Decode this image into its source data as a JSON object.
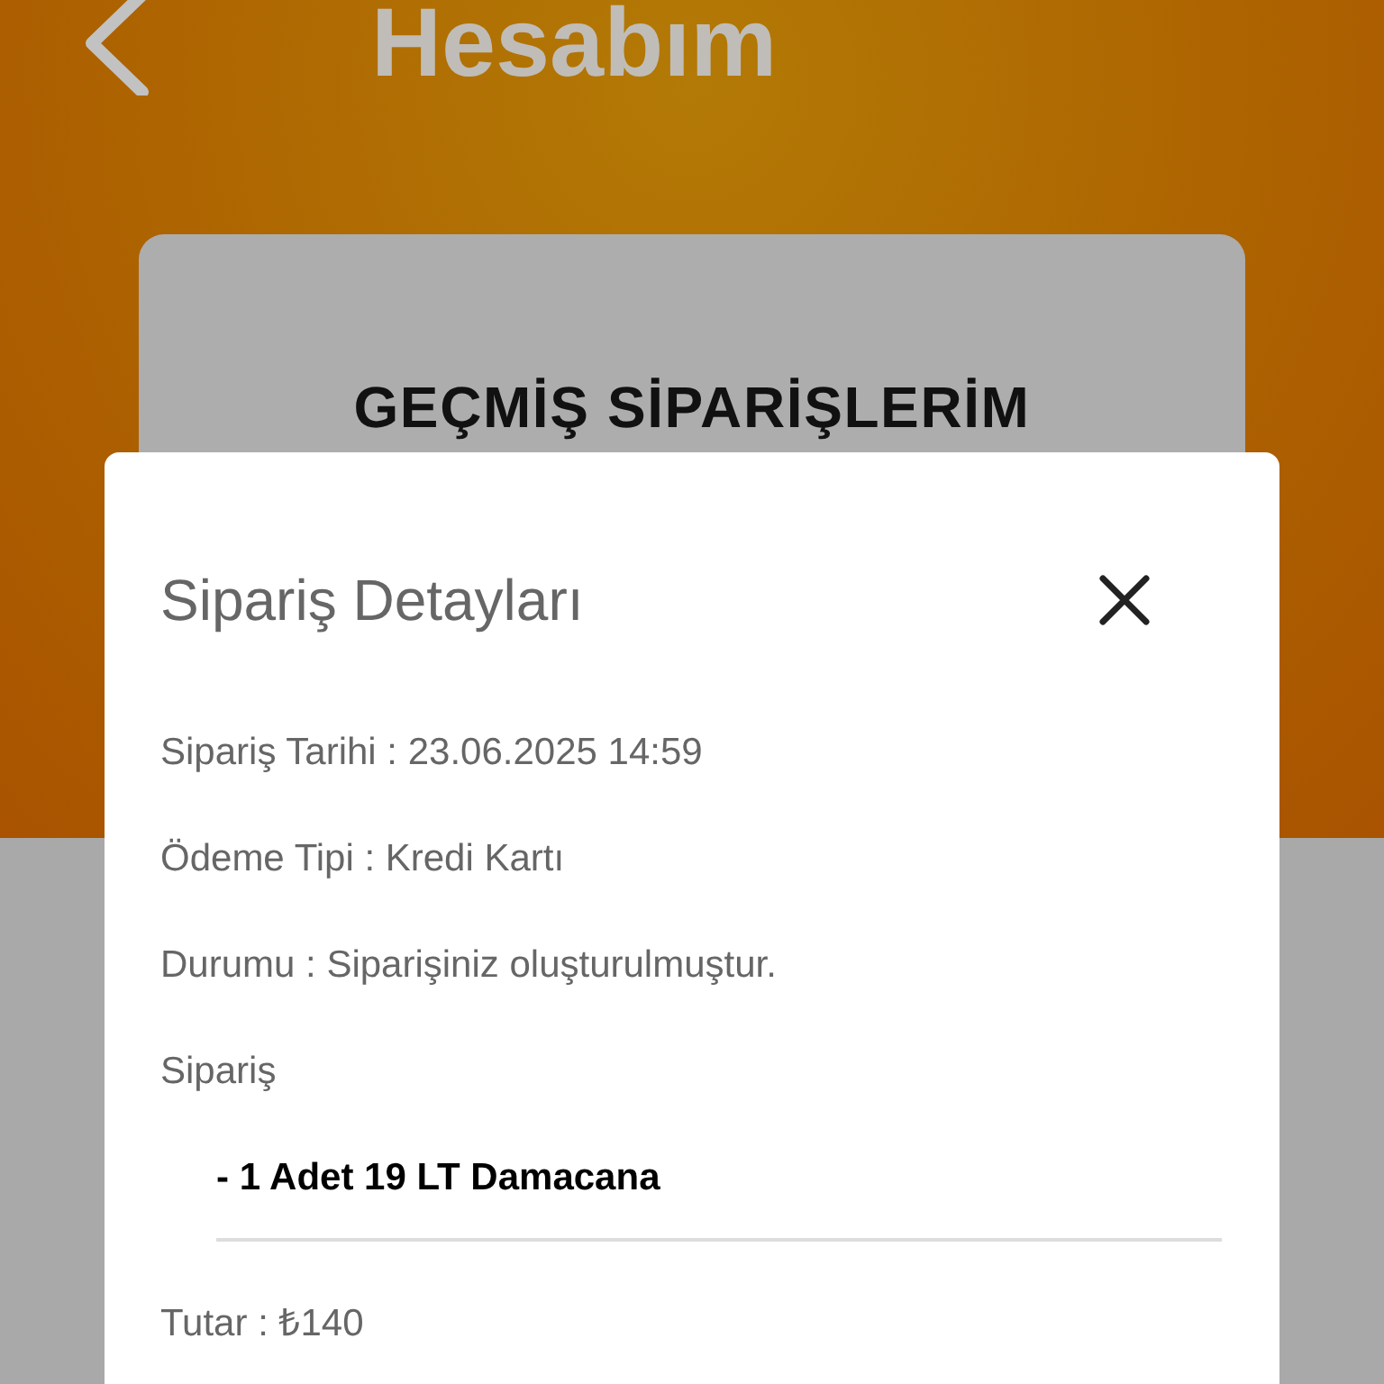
{
  "header": {
    "title": "Hesabım"
  },
  "card": {
    "title": "GEÇMİŞ SİPARİŞLERİM"
  },
  "modal": {
    "title": "Sipariş Detayları",
    "details": [
      {
        "text": "Sipariş Tarihi : 23.06.2025 14:59"
      },
      {
        "text": "Ödeme Tipi : Kredi Kartı"
      },
      {
        "text": "Durumu : Siparişiniz oluşturulmuştur."
      }
    ],
    "order_heading": "Sipariş",
    "items": [
      "- 1 Adet 19 LT Damacana"
    ],
    "total": "Tutar : ₺140"
  }
}
